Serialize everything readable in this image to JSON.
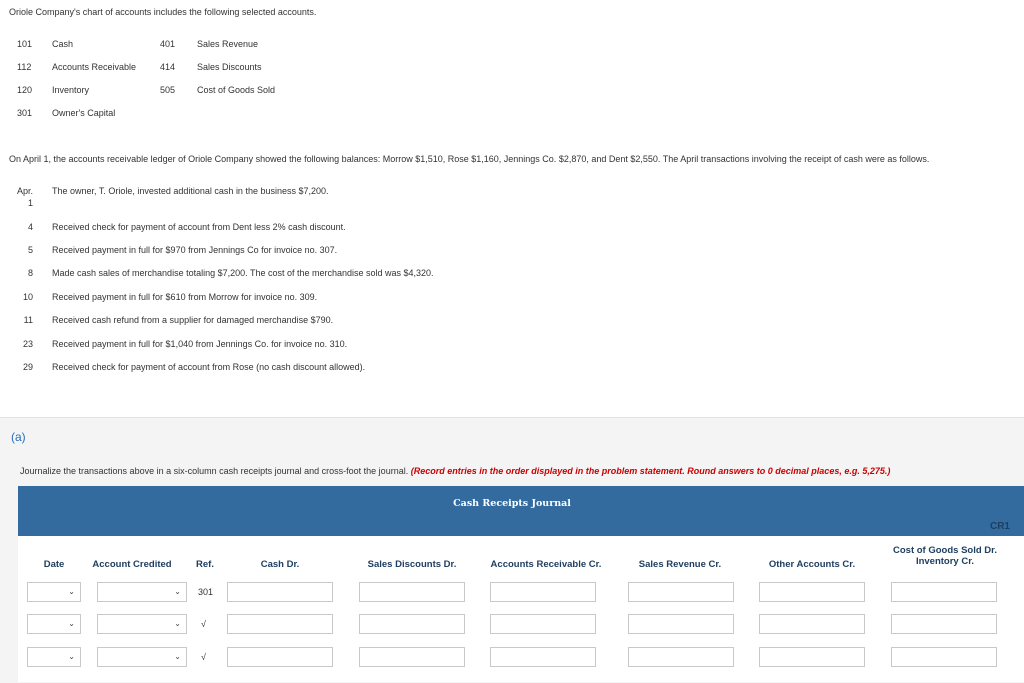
{
  "intro": "Oriole Company's chart of accounts includes the following selected accounts.",
  "accounts_left": [
    {
      "num": "101",
      "name": "Cash"
    },
    {
      "num": "112",
      "name": "Accounts Receivable"
    },
    {
      "num": "120",
      "name": "Inventory"
    },
    {
      "num": "301",
      "name": "Owner's Capital"
    }
  ],
  "accounts_right": [
    {
      "num": "401",
      "name": "Sales Revenue"
    },
    {
      "num": "414",
      "name": "Sales Discounts"
    },
    {
      "num": "505",
      "name": "Cost of Goods Sold"
    }
  ],
  "ledger_text": "On April 1, the accounts receivable ledger of Oriole Company showed the following balances: Morrow $1,510, Rose $1,160, Jennings Co. $2,870, and Dent $2,550. The April transactions involving the receipt of cash were as follows.",
  "month_label": "Apr.",
  "transactions": [
    {
      "day": "1",
      "text": "The owner, T. Oriole, invested additional cash in the business $7,200."
    },
    {
      "day": "4",
      "text": "Received check for payment of account from Dent less 2% cash discount."
    },
    {
      "day": "5",
      "text": "Received payment in full for $970 from Jennings Co for invoice no. 307."
    },
    {
      "day": "8",
      "text": "Made cash sales of merchandise totaling $7,200. The cost of the merchandise sold was $4,320."
    },
    {
      "day": "10",
      "text": "Received payment in full for $610 from Morrow for invoice no. 309."
    },
    {
      "day": "11",
      "text": "Received cash refund from a supplier for damaged merchandise $790."
    },
    {
      "day": "23",
      "text": "Received payment in full for $1,040 from Jennings Co. for invoice no. 310."
    },
    {
      "day": "29",
      "text": "Received check for payment of account from Rose (no cash discount allowed)."
    }
  ],
  "part_label": "(a)",
  "instructions": "Journalize the transactions above in a six-column cash receipts journal and cross-foot the journal. ",
  "instructions_emph": "(Record entries in the order displayed in the problem statement. Round answers to 0 decimal places, e.g. 5,275.)",
  "journal": {
    "title": "Cash Receipts Journal",
    "page_ref": "CR1",
    "columns": {
      "date": "Date",
      "account": "Account Credited",
      "ref": "Ref.",
      "cash": "Cash Dr.",
      "sales_disc": "Sales Discounts Dr.",
      "ar": "Accounts Receivable Cr.",
      "sales_rev": "Sales Revenue Cr.",
      "other": "Other Accounts Cr.",
      "cogs_line1": "Cost of Goods Sold Dr.",
      "cogs_line2": "Inventory Cr."
    },
    "rows": [
      {
        "ref": "301"
      },
      {
        "ref": "√"
      },
      {
        "ref": "√"
      }
    ]
  }
}
